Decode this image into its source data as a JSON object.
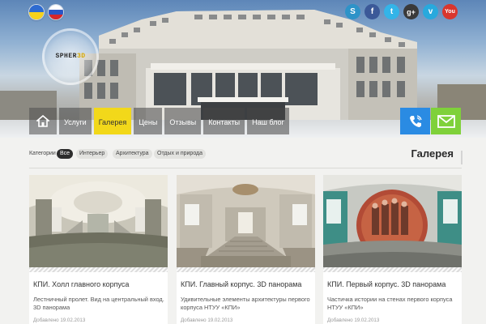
{
  "header": {
    "languages": [
      {
        "code": "ua",
        "icon": "ukraine-flag-icon"
      },
      {
        "code": "ru",
        "icon": "russia-flag-icon"
      }
    ],
    "logo": {
      "text_main": "SPHER",
      "text_accent": "3D"
    },
    "social": [
      {
        "name": "skype",
        "glyph": "S",
        "color": "#2e93c8"
      },
      {
        "name": "facebook",
        "glyph": "f",
        "color": "#3b5998"
      },
      {
        "name": "twitter",
        "glyph": "t",
        "color": "#33b4e8"
      },
      {
        "name": "google-plus",
        "glyph": "g+",
        "color": "#3a3a3a"
      },
      {
        "name": "vimeo",
        "glyph": "v",
        "color": "#28a9dd"
      },
      {
        "name": "youtube",
        "glyph": "You",
        "color": "#d9362d"
      }
    ]
  },
  "nav": {
    "home_icon": "home-icon",
    "items": [
      {
        "label": "Услуги",
        "active": false
      },
      {
        "label": "Галерея",
        "active": true
      },
      {
        "label": "Цены",
        "active": false
      },
      {
        "label": "Отзывы",
        "active": false
      },
      {
        "label": "Контакты",
        "active": false
      },
      {
        "label": "Наш блог",
        "active": false
      }
    ],
    "phone_icon": "phone-icon",
    "mail_icon": "mail-icon"
  },
  "filters": {
    "label": "Категории",
    "tags": [
      {
        "label": "Все",
        "active": true
      },
      {
        "label": "Интерьер",
        "active": false
      },
      {
        "label": "Архитектура",
        "active": false
      },
      {
        "label": "Отдых и природа",
        "active": false
      }
    ],
    "section_title": "Галерея"
  },
  "cards": [
    {
      "title": "КПИ. Холл главного корпуса",
      "description": "Лестничный пролет. Вид на центральный вход. 3D панорама",
      "date": "Добавлено 19.02.2013"
    },
    {
      "title": "КПИ. Главный корпус. 3D панорама",
      "description": "Удивительные элементы архитектуры первого корпуса НТУУ «КПИ»",
      "date": "Добавлено 19.02.2013"
    },
    {
      "title": "КПИ. Первый корпус. 3D панорама",
      "description": "Частичка истории на стенах первого корпуса НТУУ «КПИ»",
      "date": "Добавлено 19.02.2013"
    }
  ],
  "colors": {
    "nav_active": "#f2d81a",
    "phone_button": "#2a8be3",
    "mail_button": "#7fd13a"
  }
}
